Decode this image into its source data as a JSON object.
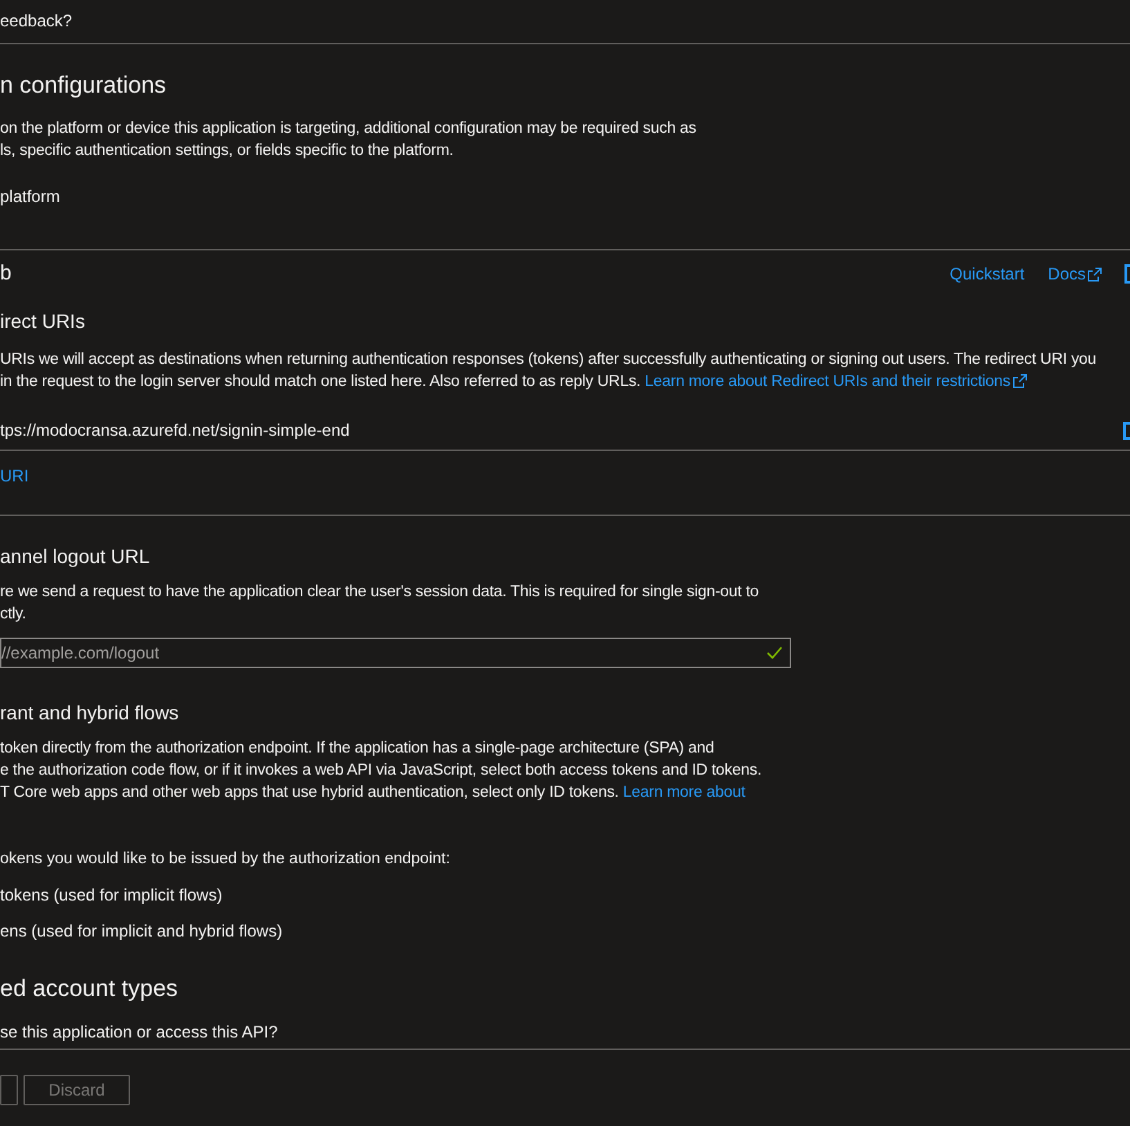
{
  "feedback": "eedback?",
  "platform_section": {
    "title": "n configurations",
    "description": [
      "on the platform or device this application is targeting, additional configuration may be required such as",
      "ls, specific authentication settings, or fields specific to the platform."
    ],
    "add_platform": "platform"
  },
  "web": {
    "title": "b",
    "links": [
      "Quickstart",
      "Docs"
    ],
    "redirect": {
      "title": "irect URIs",
      "description": [
        "URIs we will accept as destinations when returning authentication responses (tokens) after successfully authenticating or signing out users. The redirect URI you",
        "in the request to the login server should match one listed here. Also referred to as reply URLs. "
      ],
      "link": "Learn more about Redirect URIs and their restrictions",
      "uris": [
        "tps://modocransa.azurefd.net/signin-simple-end"
      ],
      "add_uri": "URI"
    },
    "logout": {
      "title": "annel logout URL",
      "description": [
        "re we send a request to have the application clear the user's session data. This is required for single sign-out to",
        "ctly."
      ],
      "placeholder": "//example.com/logout",
      "valid": true
    },
    "implicit": {
      "title": "rant and hybrid flows",
      "description": [
        "token directly from the authorization endpoint. If the application has a single-page architecture (SPA) and",
        "e the authorization code flow, or if it invokes a web API via JavaScript, select both access tokens and ID tokens.",
        "T Core web apps and other web apps that use hybrid authentication, select only ID tokens. "
      ],
      "link": "Learn more about",
      "prompt": "okens you would like to be issued by the authorization endpoint:",
      "options": [
        "tokens (used for implicit flows)",
        "ens (used for implicit and hybrid flows)"
      ]
    }
  },
  "account_types": {
    "title": "ed account types",
    "question": "se this application or access this API?"
  },
  "footer": {
    "buttons": [
      {
        "kind": "primary",
        "disabled": true
      },
      {
        "kind": "secondary",
        "label": "Discard",
        "disabled": true
      }
    ]
  }
}
